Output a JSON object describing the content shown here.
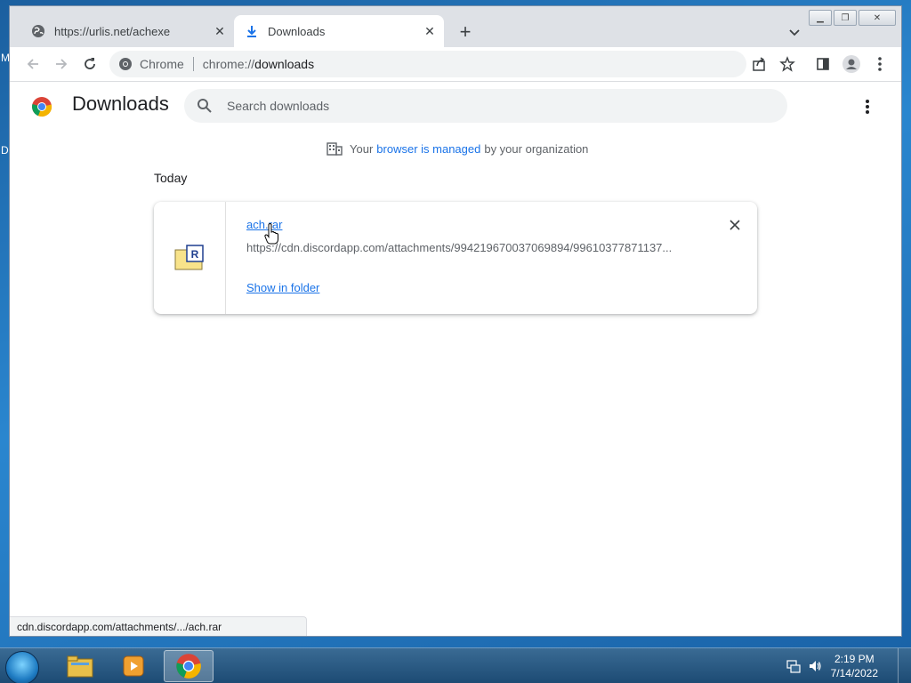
{
  "desktop": {
    "glyph_top": "M",
    "glyph_mid": "D"
  },
  "browser": {
    "tabs": [
      {
        "title": "https://urlis.net/achexe",
        "active": false
      },
      {
        "title": "Downloads",
        "active": true
      }
    ],
    "omnibox": {
      "chip_label": "Chrome",
      "url_scheme": "chrome://",
      "url_host": "downloads"
    }
  },
  "downloads": {
    "title": "Downloads",
    "search_placeholder": "Search downloads",
    "managed": {
      "prefix": "Your",
      "link": "browser is managed",
      "suffix": "by your organization"
    },
    "section": "Today",
    "items": [
      {
        "file_name": "ach.rar",
        "url": "https://cdn.discordapp.com/attachments/994219670037069894/99610377871137...",
        "action": "Show in folder"
      }
    ]
  },
  "status_bar": {
    "text": "cdn.discordapp.com/attachments/.../ach.rar"
  },
  "taskbar": {
    "time": "2:19 PM",
    "date": "7/14/2022"
  },
  "colors": {
    "accent": "#1a73e8",
    "tabstrip": "#dee1e6",
    "omnibox": "#f1f3f4"
  }
}
